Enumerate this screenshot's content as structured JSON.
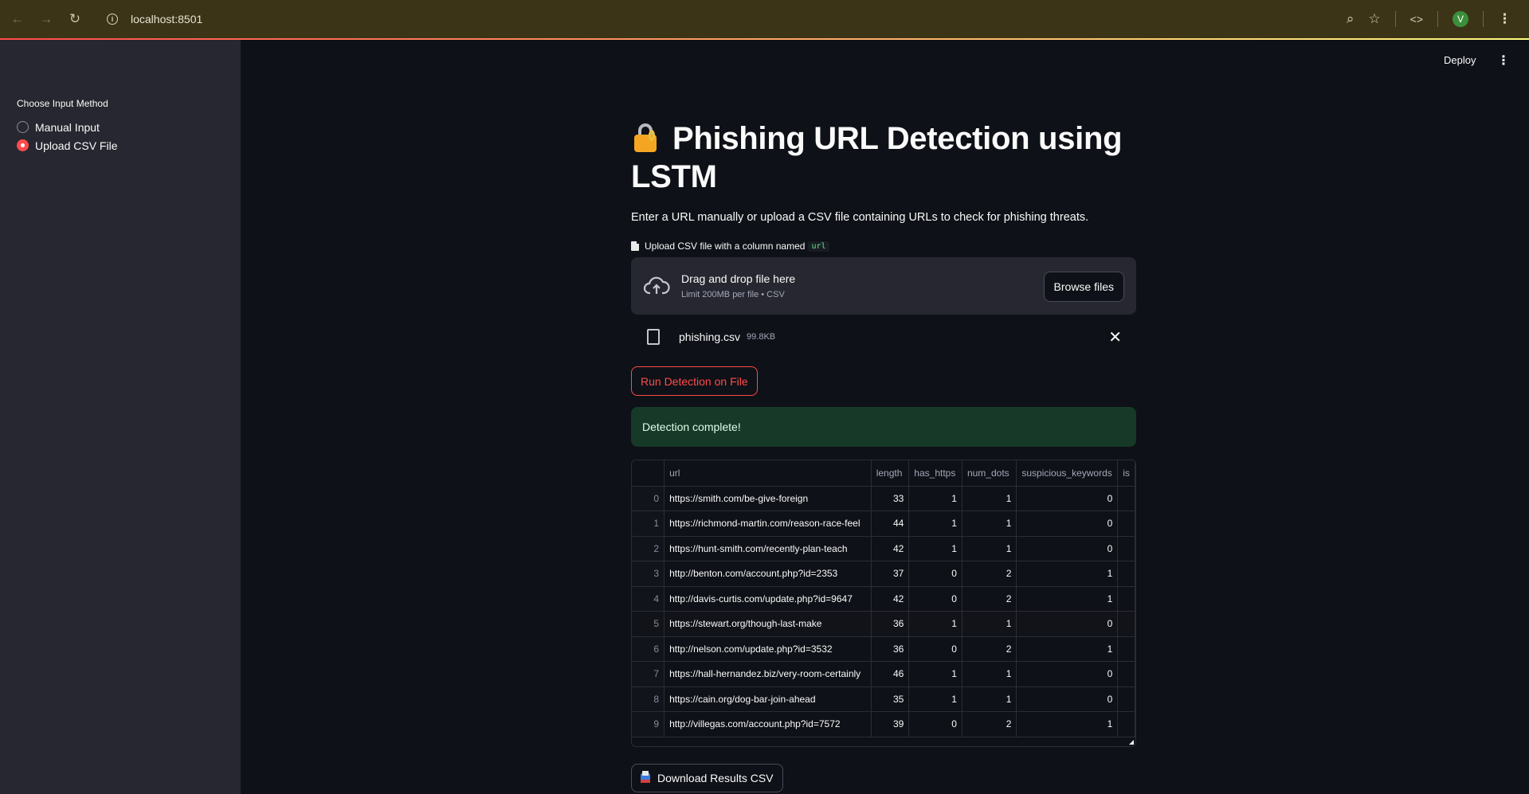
{
  "browser": {
    "url": "localhost:8501",
    "avatar_letter": "V"
  },
  "sidebar": {
    "label": "Choose Input Method",
    "options": [
      {
        "label": "Manual Input",
        "selected": false
      },
      {
        "label": "Upload CSV File",
        "selected": true
      }
    ]
  },
  "header": {
    "deploy_label": "Deploy"
  },
  "main": {
    "title": "Phishing URL Detection using LSTM",
    "description": "Enter a URL manually or upload a CSV file containing URLs to check for phishing threats.",
    "upload_label": "Upload CSV file with a column named",
    "upload_code": "url",
    "dropzone_title": "Drag and drop file here",
    "dropzone_limit": "Limit 200MB per file • CSV",
    "browse_label": "Browse files",
    "file_name": "phishing.csv",
    "file_size": "99.8KB",
    "run_label": "Run Detection on File",
    "success_message": "Detection complete!",
    "download_label": "Download Results CSV"
  },
  "table": {
    "columns": [
      "",
      "url",
      "length",
      "has_https",
      "num_dots",
      "suspicious_keywords",
      "is"
    ],
    "rows": [
      [
        "0",
        "https://smith.com/be-give-foreign",
        "33",
        "1",
        "1",
        "0"
      ],
      [
        "1",
        "https://richmond-martin.com/reason-race-feel",
        "44",
        "1",
        "1",
        "0"
      ],
      [
        "2",
        "https://hunt-smith.com/recently-plan-teach",
        "42",
        "1",
        "1",
        "0"
      ],
      [
        "3",
        "http://benton.com/account.php?id=2353",
        "37",
        "0",
        "2",
        "1"
      ],
      [
        "4",
        "http://davis-curtis.com/update.php?id=9647",
        "42",
        "0",
        "2",
        "1"
      ],
      [
        "5",
        "https://stewart.org/though-last-make",
        "36",
        "1",
        "1",
        "0"
      ],
      [
        "6",
        "http://nelson.com/update.php?id=3532",
        "36",
        "0",
        "2",
        "1"
      ],
      [
        "7",
        "https://hall-hernandez.biz/very-room-certainly",
        "46",
        "1",
        "1",
        "0"
      ],
      [
        "8",
        "https://cain.org/dog-bar-join-ahead",
        "35",
        "1",
        "1",
        "0"
      ],
      [
        "9",
        "http://villegas.com/account.php?id=7572",
        "39",
        "0",
        "2",
        "1"
      ]
    ]
  }
}
